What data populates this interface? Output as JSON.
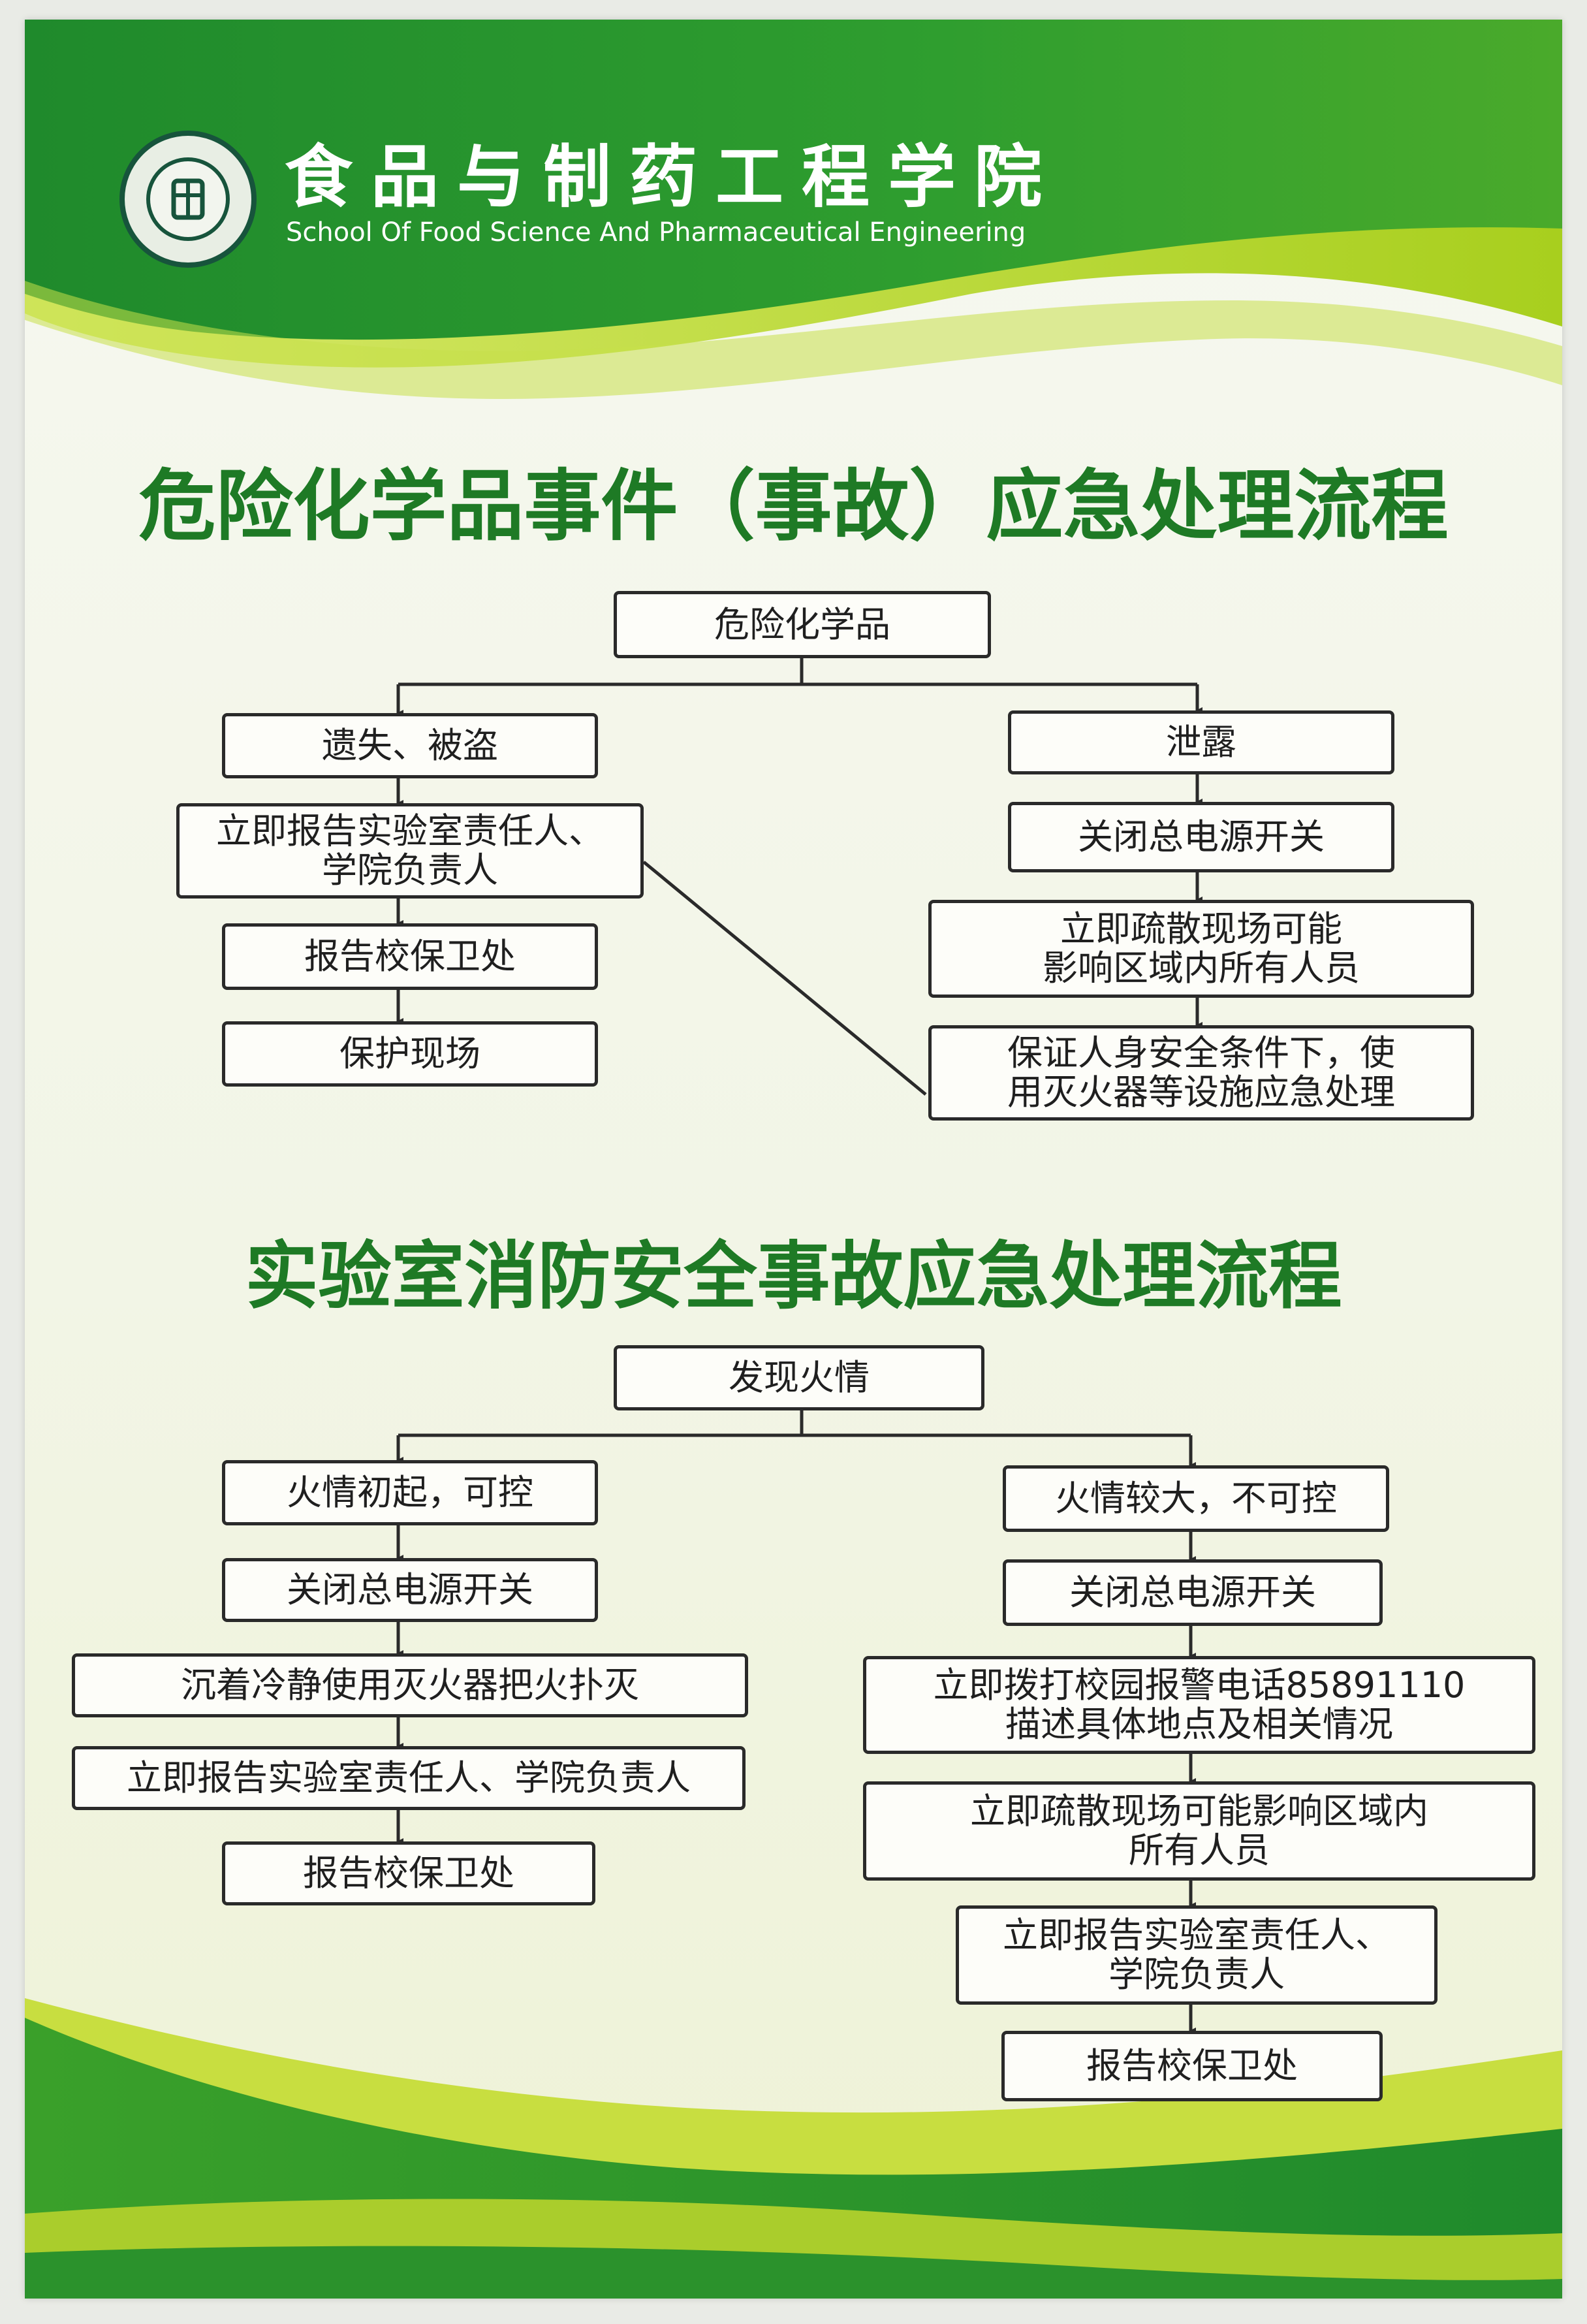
{
  "header": {
    "school_name_cn": "食品与制药工程学院",
    "school_name_en": "School Of Food Science And Pharmaceutical Engineering"
  },
  "chemical_flow": {
    "title": "危险化学品事件（事故）应急处理流程",
    "root": "危险化学品",
    "left_branch": [
      "遗失、被盗",
      "立即报告实验室责任人、\n学院负责人",
      "报告校保卫处",
      "保护现场"
    ],
    "right_branch": [
      "泄露",
      "关闭总电源开关",
      "立即疏散现场可能\n影响区域内所有人员",
      "保证人身安全条件下，使\n用灭火器等设施应急处理"
    ]
  },
  "fire_flow": {
    "title": "实验室消防安全事故应急处理流程",
    "root": "发现火情",
    "left_branch": [
      "火情初起，可控",
      "关闭总电源开关",
      "沉着冷静使用灭火器把火扑灭",
      "立即报告实验室责任人、学院负责人",
      "报告校保卫处"
    ],
    "right_branch": [
      "火情较大，不可控",
      "关闭总电源开关",
      "立即拨打校园报警电话85891110\n描述具体地点及相关情况",
      "立即疏散现场可能影响区域内\n所有人员",
      "立即报告实验室责任人、\n学院负责人",
      "报告校保卫处"
    ]
  },
  "colors": {
    "header_green": "#2a9a2f",
    "light_green": "#b8d82e",
    "title_green": "#1e7a25"
  }
}
